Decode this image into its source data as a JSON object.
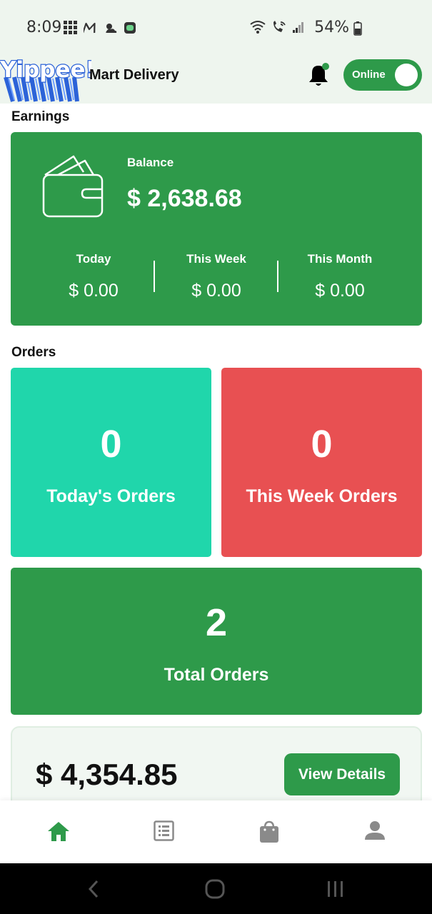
{
  "status_bar": {
    "time": "8:09",
    "battery": "54%",
    "left_icons": [
      "apps-grid-icon",
      "gmail-icon",
      "weather-icon",
      "messaging-icon"
    ],
    "right_icons": [
      "wifi-icon",
      "wifi-calling-icon",
      "signal-icon",
      "battery-icon"
    ]
  },
  "header": {
    "logo_text": "Yippee!",
    "app_name": "Mart Delivery",
    "status_toggle": {
      "label": "Online",
      "on": true
    },
    "notification_dot": true
  },
  "earnings": {
    "title": "Earnings",
    "balance_label": "Balance",
    "balance_value": "$ 2,638.68",
    "periods": [
      {
        "label": "Today",
        "value": "$ 0.00"
      },
      {
        "label": "This Week",
        "value": "$ 0.00"
      },
      {
        "label": "This Month",
        "value": "$ 0.00"
      }
    ]
  },
  "orders": {
    "title": "Orders",
    "today": {
      "count": "0",
      "label": "Today's Orders"
    },
    "week": {
      "count": "0",
      "label": "This Week Orders"
    },
    "total": {
      "count": "2",
      "label": "Total Orders"
    }
  },
  "summary": {
    "amount": "$ 4,354.85",
    "button_label": "View Details"
  },
  "bottom_nav": {
    "items": [
      "home-icon",
      "orders-list-icon",
      "shopping-bag-icon",
      "profile-icon"
    ],
    "active": "home-icon"
  },
  "colors": {
    "primary_green": "#2e9a4a",
    "teal": "#20d6ab",
    "red": "#e85052",
    "header_bg": "#eef5ee"
  }
}
